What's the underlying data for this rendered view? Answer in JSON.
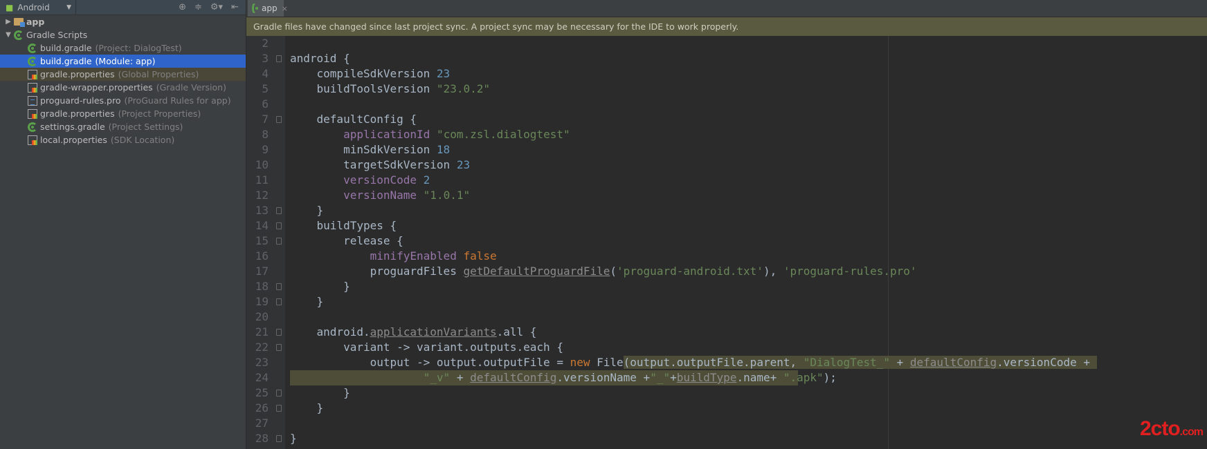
{
  "sidebar": {
    "view": "Android",
    "tools": [
      "⊕",
      "≑",
      "⚙▾",
      "⇤"
    ],
    "items": [
      {
        "label": "app",
        "hint": "",
        "icon": "folder-icon",
        "depth": 0,
        "arrow": "▶"
      },
      {
        "label": "Gradle Scripts",
        "hint": "",
        "icon": "gradle-icon",
        "depth": 0,
        "arrow": "▼"
      },
      {
        "label": "build.gradle",
        "hint": "(Project: DialogTest)",
        "icon": "gradle-icon",
        "depth": 1
      },
      {
        "label": "build.gradle",
        "hint": "(Module: app)",
        "icon": "gradle-icon",
        "depth": 1,
        "selected": true
      },
      {
        "label": "gradle.properties",
        "hint": "(Global Properties)",
        "icon": "properties-icon",
        "depth": 1,
        "alt": true
      },
      {
        "label": "gradle-wrapper.properties",
        "hint": "(Gradle Version)",
        "icon": "properties-icon",
        "depth": 1
      },
      {
        "label": "proguard-rules.pro",
        "hint": "(ProGuard Rules for app)",
        "icon": "text-file-icon",
        "depth": 1
      },
      {
        "label": "gradle.properties",
        "hint": "(Project Properties)",
        "icon": "properties-icon",
        "depth": 1
      },
      {
        "label": "settings.gradle",
        "hint": "(Project Settings)",
        "icon": "gradle-icon",
        "depth": 1
      },
      {
        "label": "local.properties",
        "hint": "(SDK Location)",
        "icon": "properties-icon",
        "depth": 1
      }
    ]
  },
  "tab": {
    "label": "app",
    "close": "×"
  },
  "banner": "Gradle files have changed since last project sync. A project sync may be necessary for the IDE to work properly.",
  "watermark": {
    "main": "2cto",
    "suffix": ".com"
  },
  "lines": [
    {
      "n": "2",
      "t": []
    },
    {
      "n": "3",
      "fold": true,
      "t": [
        [
          "android {",
          ""
        ]
      ]
    },
    {
      "n": "4",
      "t": [
        [
          "    compileSdkVersion ",
          ""
        ],
        [
          "23",
          "num"
        ]
      ]
    },
    {
      "n": "5",
      "t": [
        [
          "    buildToolsVersion ",
          ""
        ],
        [
          "\"23.0.2\"",
          "str"
        ]
      ]
    },
    {
      "n": "6",
      "t": []
    },
    {
      "n": "7",
      "fold": true,
      "t": [
        [
          "    defaultConfig {",
          ""
        ]
      ]
    },
    {
      "n": "8",
      "t": [
        [
          "        ",
          ""
        ],
        [
          "applicationId",
          "prop"
        ],
        [
          " ",
          ""
        ],
        [
          "\"com.zsl.dialogtest\"",
          "str"
        ]
      ]
    },
    {
      "n": "9",
      "t": [
        [
          "        minSdkVersion ",
          ""
        ],
        [
          "18",
          "num"
        ]
      ]
    },
    {
      "n": "10",
      "t": [
        [
          "        targetSdkVersion ",
          ""
        ],
        [
          "23",
          "num"
        ]
      ]
    },
    {
      "n": "11",
      "t": [
        [
          "        ",
          ""
        ],
        [
          "versionCode",
          "prop"
        ],
        [
          " ",
          ""
        ],
        [
          "2",
          "num"
        ]
      ]
    },
    {
      "n": "12",
      "t": [
        [
          "        ",
          ""
        ],
        [
          "versionName",
          "prop"
        ],
        [
          " ",
          ""
        ],
        [
          "\"1.0.1\"",
          "str"
        ]
      ]
    },
    {
      "n": "13",
      "fold": true,
      "t": [
        [
          "    }",
          ""
        ]
      ]
    },
    {
      "n": "14",
      "fold": true,
      "t": [
        [
          "    buildTypes {",
          ""
        ]
      ]
    },
    {
      "n": "15",
      "fold": true,
      "t": [
        [
          "        release {",
          ""
        ]
      ]
    },
    {
      "n": "16",
      "t": [
        [
          "            ",
          ""
        ],
        [
          "minifyEnabled",
          "prop"
        ],
        [
          " ",
          ""
        ],
        [
          "false",
          "kw"
        ]
      ]
    },
    {
      "n": "17",
      "t": [
        [
          "            proguardFiles ",
          ""
        ],
        [
          "getDefaultProguardFile",
          "und"
        ],
        [
          "(",
          ""
        ],
        [
          "'proguard-android.txt'",
          "str"
        ],
        [
          "), ",
          ""
        ],
        [
          "'proguard-rules.pro'",
          "str"
        ]
      ]
    },
    {
      "n": "18",
      "fold": true,
      "t": [
        [
          "        }",
          ""
        ]
      ]
    },
    {
      "n": "19",
      "fold": true,
      "t": [
        [
          "    }",
          ""
        ]
      ]
    },
    {
      "n": "20",
      "t": []
    },
    {
      "n": "21",
      "fold": true,
      "t": [
        [
          "    android.",
          ""
        ],
        [
          "applicationVariants",
          "und"
        ],
        [
          ".all {",
          ""
        ]
      ]
    },
    {
      "n": "22",
      "fold": true,
      "t": [
        [
          "        variant -> variant.outputs.each {",
          ""
        ]
      ]
    },
    {
      "n": "23",
      "t": [
        [
          "            output -> output.outputFile = ",
          ""
        ],
        [
          "new",
          "kw"
        ],
        [
          " File",
          ""
        ],
        [
          "(output.outputFile.parent, ",
          "hl"
        ],
        [
          "\"DialogTest_\"",
          "str hl"
        ],
        [
          " + ",
          "hl"
        ],
        [
          "defaultConfig",
          "und hl"
        ],
        [
          ".versionCode + ",
          "hl"
        ]
      ]
    },
    {
      "n": "24",
      "hlrow": true,
      "t": [
        [
          "                    ",
          ""
        ],
        [
          "\"_v\"",
          "str"
        ],
        [
          " + ",
          ""
        ],
        [
          "defaultConfig",
          "und"
        ],
        [
          ".versionName +",
          ""
        ],
        [
          "\"_\"",
          "str"
        ],
        [
          "+",
          ""
        ],
        [
          "buildType",
          "und"
        ],
        [
          ".name+ ",
          ""
        ],
        [
          "\".apk\"",
          "str"
        ],
        [
          ");",
          ""
        ]
      ]
    },
    {
      "n": "25",
      "fold": true,
      "t": [
        [
          "        }",
          ""
        ]
      ]
    },
    {
      "n": "26",
      "fold": true,
      "t": [
        [
          "    }",
          ""
        ]
      ]
    },
    {
      "n": "27",
      "t": []
    },
    {
      "n": "28",
      "fold": true,
      "t": [
        [
          "}",
          ""
        ]
      ]
    }
  ]
}
